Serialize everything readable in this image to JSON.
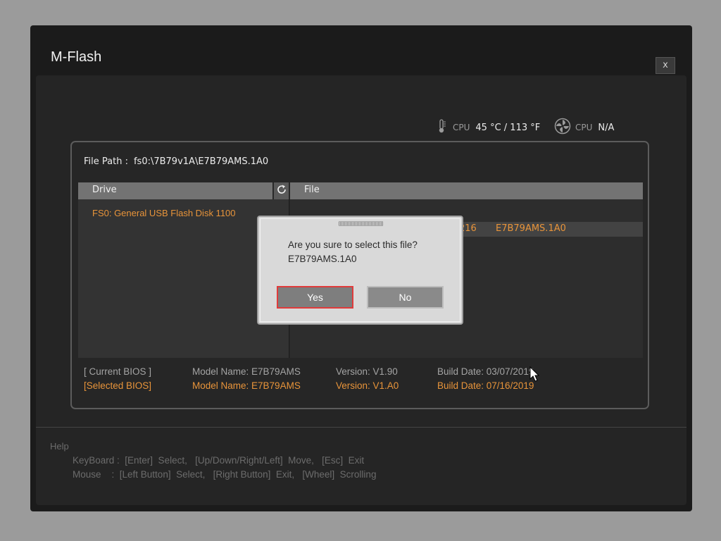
{
  "window": {
    "title": "M-Flash",
    "close_label": "x"
  },
  "sensors": {
    "cpu_temp": {
      "label": "CPU",
      "value": "45 °C / 113 °F",
      "icon": "thermometer-icon"
    },
    "cpu_fan": {
      "label": "CPU",
      "value": "N/A",
      "icon": "fan-icon"
    }
  },
  "panel": {
    "file_path_label": "File Path :",
    "file_path_value": "fs0:\\7B79v1A\\E7B79AMS.1A0",
    "drive_header": "Drive",
    "file_header": "File",
    "drives": [
      {
        "label": "FS0: General USB Flash Disk 1100"
      }
    ],
    "files": [
      {
        "size": "216",
        "name": "E7B79AMS.1A0"
      }
    ]
  },
  "bios": {
    "current": {
      "label": "[ Current BIOS ]",
      "model": "Model Name: E7B79AMS",
      "version": "Version: V1.90",
      "date": "Build Date: 03/07/2019"
    },
    "selected": {
      "label": "[Selected BIOS]",
      "model": "Model Name: E7B79AMS",
      "version": "Version: V1.A0",
      "date": "Build Date: 07/16/2019"
    }
  },
  "help": {
    "title": "Help",
    "keyboard": "KeyBoard :  [Enter]  Select,   [Up/Down/Right/Left]  Move,   [Esc]  Exit",
    "mouse": "Mouse    :  [Left Button]  Select,   [Right Button]  Exit,   [Wheel]  Scrolling"
  },
  "dialog": {
    "question": "Are you sure to select this file?",
    "filename": "E7B79AMS.1A0",
    "yes_label": "Yes",
    "no_label": "No"
  },
  "colors": {
    "accent": "#e8943a",
    "focus": "#e03b3b",
    "background": "#1b1b1b"
  }
}
